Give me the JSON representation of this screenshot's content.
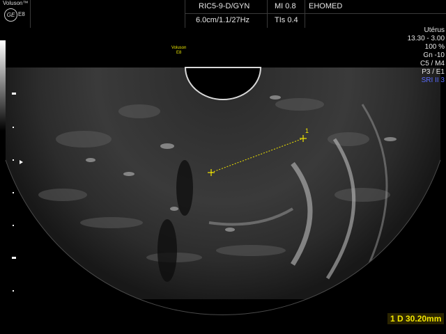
{
  "header": {
    "brand": "Voluson™",
    "ge_logo": "GE",
    "model": "E8",
    "probe": "RIC5-9-D/GYN",
    "depth_freq": "6.0cm/1.1/27Hz",
    "mi": "MI 0.8",
    "tis": "TIs 0.4",
    "institution": "EHOMED"
  },
  "probe_mark": {
    "brand": "Voluson",
    "model": "E8"
  },
  "params": {
    "organ": "Utérus",
    "range": "13.30 - 3.00",
    "power": "100 %",
    "gain": "Gn -10",
    "c_m": "C5 / M4",
    "p_e": "P3 / E1",
    "sri": "SRI II 3"
  },
  "measurement": {
    "marker_index": "1",
    "label": "1  D 30.20mm"
  },
  "colors": {
    "caliper": "#f3e600",
    "sri": "#5a6cff"
  }
}
